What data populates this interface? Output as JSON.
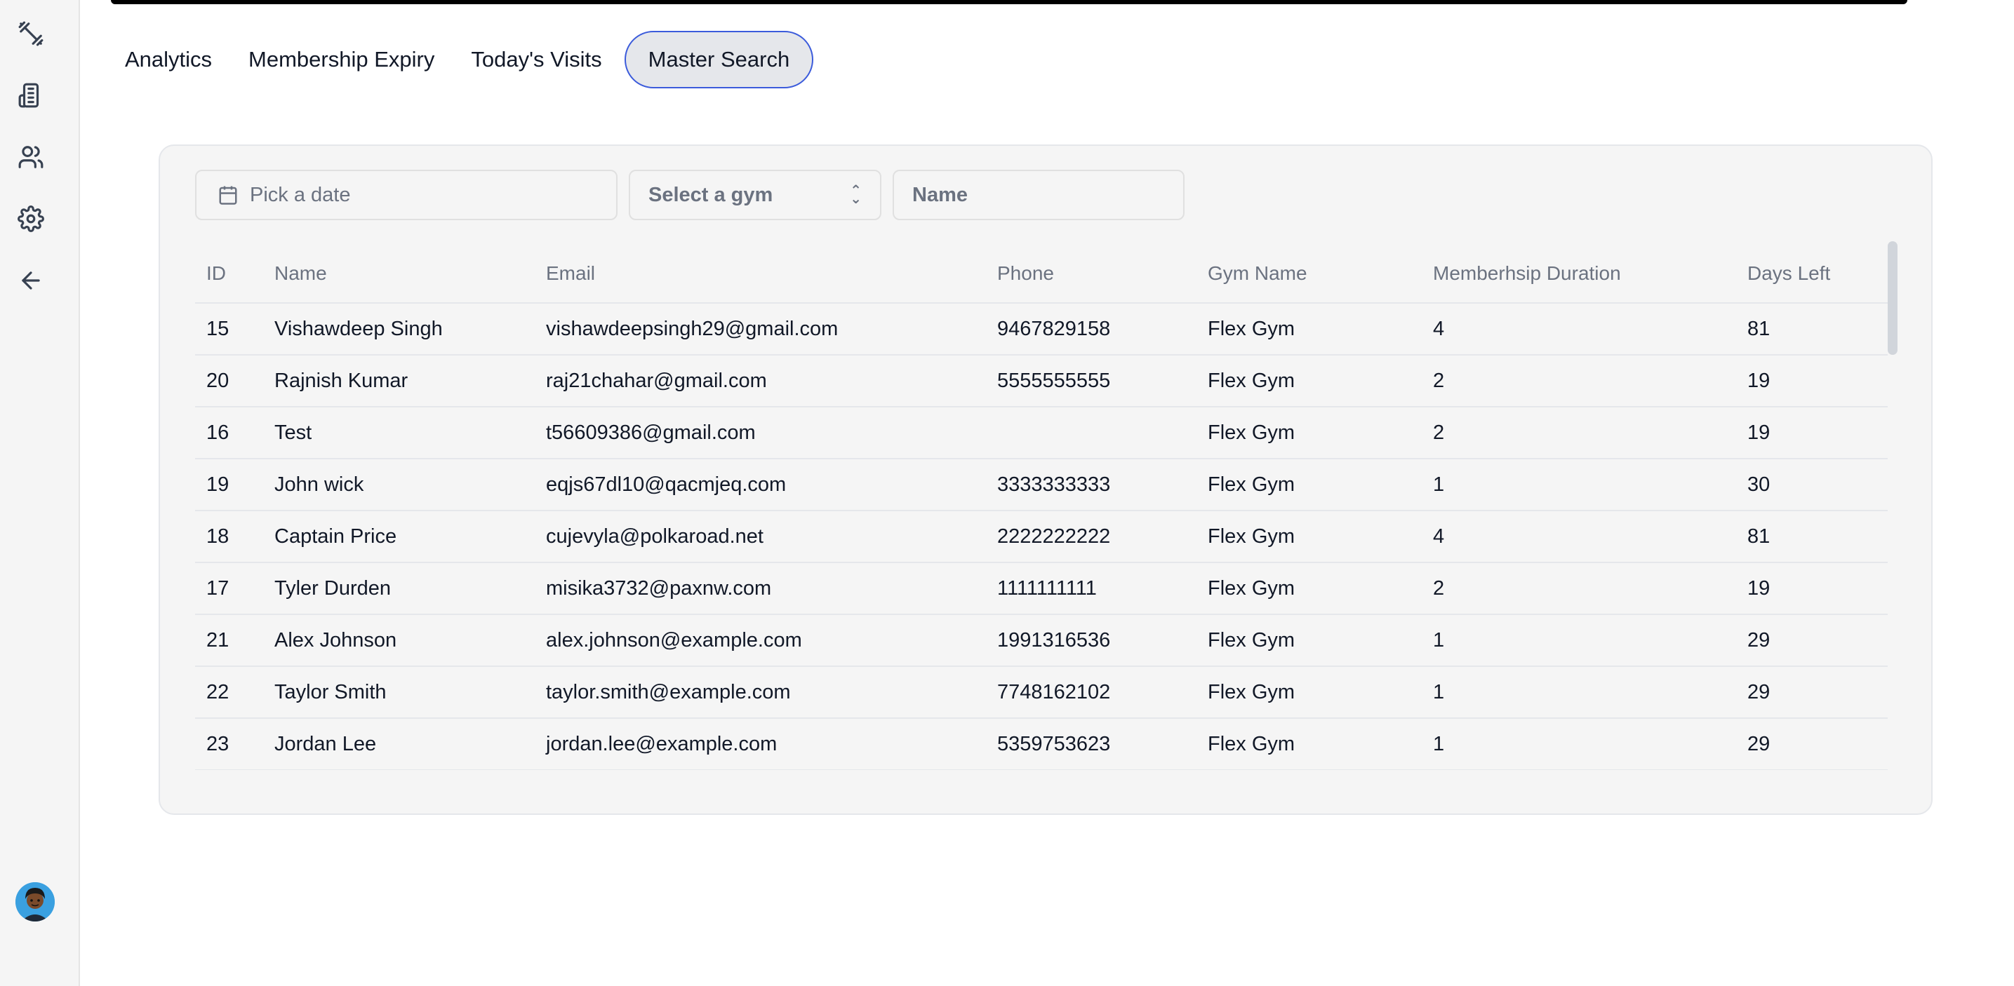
{
  "sidebar": {
    "icons": [
      "dumbbell-icon",
      "building-icon",
      "users-icon",
      "gear-icon",
      "arrow-left-icon"
    ],
    "avatar": "user-avatar"
  },
  "tabs": [
    {
      "label": "Analytics",
      "active": false
    },
    {
      "label": "Membership Expiry",
      "active": false
    },
    {
      "label": "Today's Visits",
      "active": false
    },
    {
      "label": "Master Search",
      "active": true
    }
  ],
  "filters": {
    "date_placeholder": "Pick a date",
    "gym_placeholder": "Select a gym",
    "name_placeholder": "Name"
  },
  "table": {
    "headers": [
      "ID",
      "Name",
      "Email",
      "Phone",
      "Gym Name",
      "Memberhsip Duration",
      "Days Left"
    ],
    "rows": [
      [
        "15",
        "Vishawdeep Singh",
        "vishawdeepsingh29@gmail.com",
        "9467829158",
        "Flex Gym",
        "4",
        "81"
      ],
      [
        "20",
        "Rajnish Kumar",
        "raj21chahar@gmail.com",
        "5555555555",
        "Flex Gym",
        "2",
        "19"
      ],
      [
        "16",
        "Test",
        "t56609386@gmail.com",
        "",
        "Flex Gym",
        "2",
        "19"
      ],
      [
        "19",
        "John wick",
        "eqjs67dl10@qacmjeq.com",
        "3333333333",
        "Flex Gym",
        "1",
        "30"
      ],
      [
        "18",
        "Captain Price",
        "cujevyla@polkaroad.net",
        "2222222222",
        "Flex Gym",
        "4",
        "81"
      ],
      [
        "17",
        "Tyler Durden",
        "misika3732@paxnw.com",
        "1111111111",
        "Flex Gym",
        "2",
        "19"
      ],
      [
        "21",
        "Alex Johnson",
        "alex.johnson@example.com",
        "1991316536",
        "Flex Gym",
        "1",
        "29"
      ],
      [
        "22",
        "Taylor Smith",
        "taylor.smith@example.com",
        "7748162102",
        "Flex Gym",
        "1",
        "29"
      ],
      [
        "23",
        "Jordan Lee",
        "jordan.lee@example.com",
        "5359753623",
        "Flex Gym",
        "1",
        "29"
      ]
    ]
  },
  "colors": {
    "active_tab_border": "#3b5bdb",
    "active_tab_bg": "#e5e7eb",
    "card_bg": "#f5f5f5"
  }
}
